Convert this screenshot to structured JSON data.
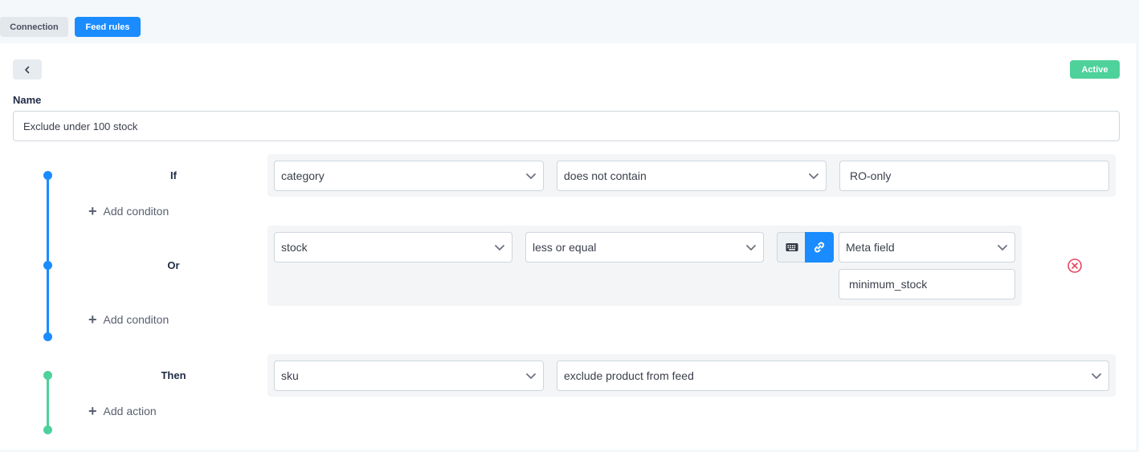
{
  "tabs": {
    "connection": "Connection",
    "feed_rules": "Feed rules"
  },
  "status_badge": "Active",
  "name_field": {
    "label": "Name",
    "value": "Exclude under 100 stock"
  },
  "conditions": {
    "if_label": "If",
    "or_label": "Or",
    "add_condition_label": "Add conditon",
    "if_row": {
      "field": "category",
      "operator": "does not contain",
      "value": "RO-only"
    },
    "or_row": {
      "field": "stock",
      "operator": "less or equal",
      "value_type": "Meta field",
      "value": "minimum_stock"
    }
  },
  "actions": {
    "then_label": "Then",
    "add_action_label": "Add action",
    "row": {
      "field": "sku",
      "action": "exclude product from feed"
    }
  },
  "colors": {
    "accent_blue": "#1a8cff",
    "active_green": "#4fd19c",
    "remove_red": "#e8455f"
  },
  "icons": {
    "back": "chevron-left-icon",
    "keyboard": "keyboard-icon",
    "link": "link-icon",
    "remove": "remove-circle-icon",
    "dropdown": "chevron-down-icon",
    "add": "plus-icon"
  }
}
